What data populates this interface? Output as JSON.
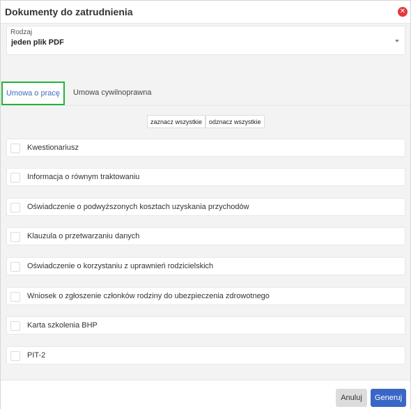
{
  "dialog": {
    "title": "Dokumenty do zatrudnienia",
    "close_glyph": "✕"
  },
  "type_select": {
    "label": "Rodzaj",
    "value": "jeden plik PDF"
  },
  "tabs": [
    {
      "label": "Umowa o pracę",
      "active": true
    },
    {
      "label": "Umowa cywilnoprawna",
      "active": false
    }
  ],
  "selection": {
    "select_all": "zaznacz wszystkie",
    "deselect_all": "odznacz wszystkie"
  },
  "documents": [
    {
      "label": "Kwestionariusz",
      "checked": false
    },
    {
      "label": "Informacja o równym traktowaniu",
      "checked": false
    },
    {
      "label": "Oświadczenie o podwyższonych kosztach uzyskania przychodów",
      "checked": false
    },
    {
      "label": "Klauzula o przetwarzaniu danych",
      "checked": false
    },
    {
      "label": "Oświadczenie o korzystaniu z uprawnień rodzicielskich",
      "checked": false
    },
    {
      "label": "Wniosek o zgłoszenie członków rodziny do ubezpieczenia zdrowotnego",
      "checked": false
    },
    {
      "label": "Karta szkolenia BHP",
      "checked": false
    },
    {
      "label": "PIT-2",
      "checked": false
    }
  ],
  "footer": {
    "cancel": "Anuluj",
    "generate": "Generuj"
  },
  "colors": {
    "active_tab_border": "#1fb439",
    "active_tab_text": "#3b6dbf",
    "primary_button": "#3a66c6",
    "close_button": "#e3393b"
  }
}
